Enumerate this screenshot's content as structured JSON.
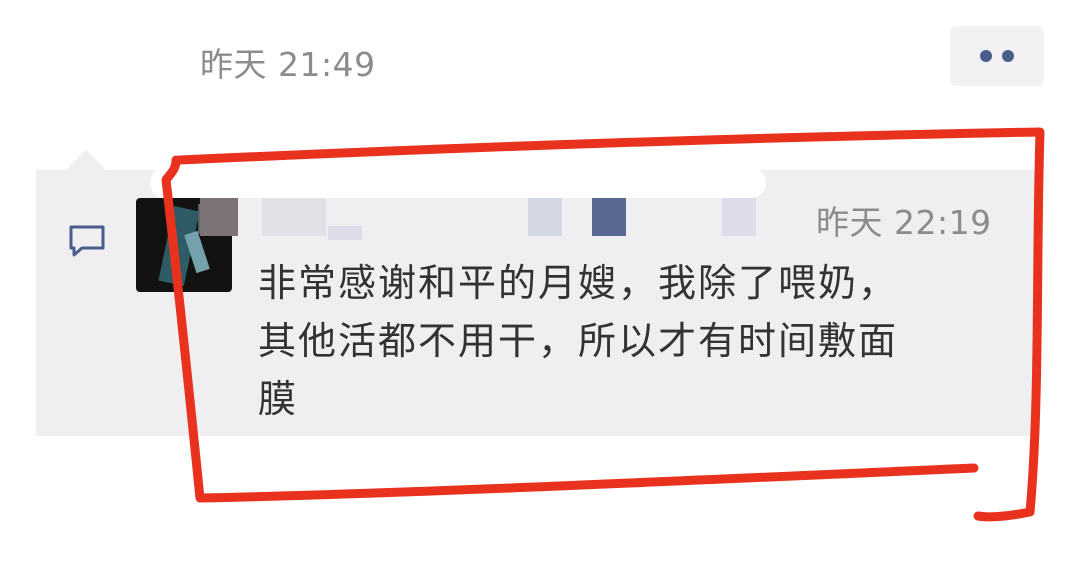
{
  "post": {
    "time": "昨天 21:49"
  },
  "more_button": {
    "icon": "more-dots-icon"
  },
  "comment": {
    "icon": "comment-icon",
    "time": "昨天 22:19",
    "text": "非常感谢和平的月嫂，我除了喂奶，\n其他活都不用干，所以才有时间敷面\n膜"
  },
  "colors": {
    "panel": "#efeff1",
    "time_text": "#8c8c8c",
    "body_text": "#333333",
    "accent": "#4a5d8a",
    "highlight": "#e8321e"
  }
}
